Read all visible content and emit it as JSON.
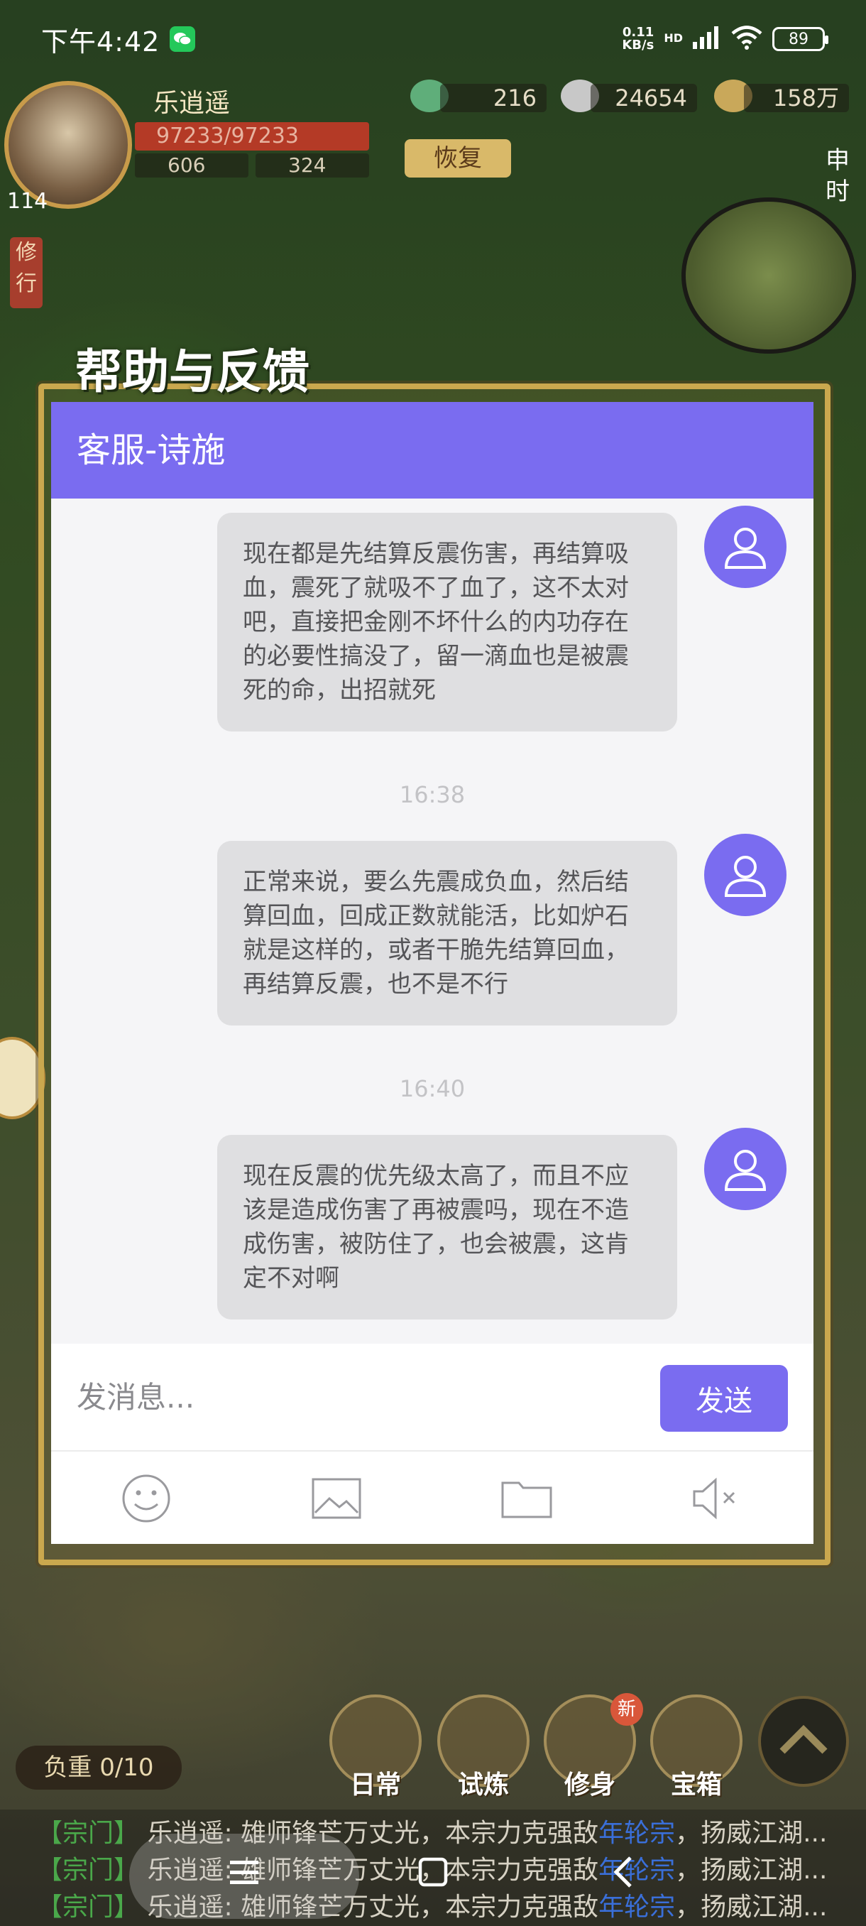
{
  "status_bar": {
    "time": "下午4:42",
    "net_speed_value": "0.11",
    "net_speed_unit": "KB/s",
    "network_type": "HD",
    "battery": "89"
  },
  "game_hud": {
    "player_name": "乐逍遥",
    "level": "114",
    "hp": "97233/97233",
    "stat_a": "606",
    "stat_b": "324",
    "currency_1": "216",
    "currency_2": "24654",
    "currency_3": "158万",
    "recover_label": "恢复",
    "time_label": "申时",
    "cultivate_label": "修行",
    "weight_label": "负重 0/10",
    "bottom_buttons": [
      {
        "label": "日常"
      },
      {
        "label": "试炼"
      },
      {
        "label": "修身"
      },
      {
        "label": "宝箱"
      }
    ],
    "new_badge": "新"
  },
  "dialog": {
    "title": "帮助与反馈",
    "header": "客服-诗施",
    "messages": [
      {
        "text": "现在都是先结算反震伤害，再结算吸血，震死了就吸不了血了，这不太对吧，直接把金刚不坏什么的内功存在的必要性搞没了，留一滴血也是被震死的命，出招就死"
      },
      {
        "timestamp": "16:38",
        "text": "正常来说，要么先震成负血，然后结算回血，回成正数就能活，比如炉石就是这样的，或者干脆先结算回血，再结算反震，也不是不行"
      },
      {
        "timestamp": "16:40",
        "text": "现在反震的优先级太高了，而且不应该是造成伤害了再被震吗，现在不造成伤害，被防住了，也会被震，这肯定不对啊"
      }
    ],
    "input_placeholder": "发消息...",
    "send_label": "发送",
    "tools": [
      "emoji-icon",
      "image-icon",
      "folder-icon",
      "mute-icon"
    ]
  },
  "chat_feed": [
    {
      "tag": "【宗门】",
      "speaker": "乐逍遥:",
      "text": "雄师锋芒万丈光，本宗力克强敌",
      "link": "年轮宗",
      "tail": "，扬威江湖..."
    },
    {
      "tag": "【宗门】",
      "speaker": "乐逍遥:",
      "text": "雄师锋芒万丈光，本宗力克强敌",
      "link": "年轮宗",
      "tail": "，扬威江湖..."
    },
    {
      "tag": "【宗门】",
      "speaker": "乐逍遥:",
      "text": "雄师锋芒万丈光，本宗力克强敌",
      "link": "年轮宗",
      "tail": "，扬威江湖..."
    }
  ],
  "colors": {
    "accent": "#7a6cf0",
    "bubble": "#dfdfe1",
    "panel": "#f5f5f7"
  }
}
